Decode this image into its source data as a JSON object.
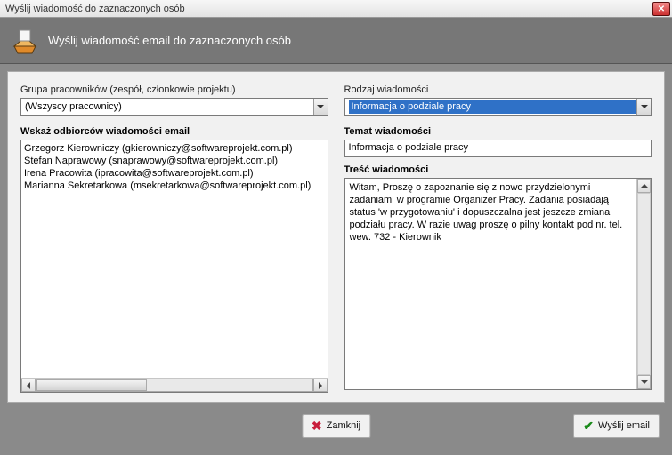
{
  "window": {
    "title": "Wyślij wiadomość do zaznaczonych osób"
  },
  "header": {
    "text": "Wyślij wiadomość email do zaznaczonych osób"
  },
  "left": {
    "group_label": "Grupa pracowników (zespół, członkowie projektu)",
    "group_value": "(Wszyscy pracownicy)",
    "recipients_label": "Wskaż odbiorców wiadomości email",
    "recipients": [
      "Grzegorz Kierowniczy (gkierowniczy@softwareprojekt.com.pl)",
      "Stefan Naprawowy (snaprawowy@softwareprojekt.com.pl)",
      "Irena Pracowita (ipracowita@softwareprojekt.com.pl)",
      "Marianna Sekretarkowa (msekretarkowa@softwareprojekt.com.pl)"
    ]
  },
  "right": {
    "type_label": "Rodzaj wiadomości",
    "type_value": "Informacja o podziale pracy",
    "subject_label": "Temat wiadomości",
    "subject_value": "Informacja o podziale pracy",
    "body_label": "Treść wiadomości",
    "body_value": "Witam, Proszę o zapoznanie się z nowo przydzielonymi zadaniami w programie Organizer Pracy. Zadania posiadają status 'w przygotowaniu' i dopuszczalna jest jeszcze zmiana podziału pracy. W razie uwag proszę o pilny kontakt pod nr. tel. wew. 732 - Kierownik"
  },
  "buttons": {
    "close": "Zamknij",
    "send": "Wyślij email"
  }
}
